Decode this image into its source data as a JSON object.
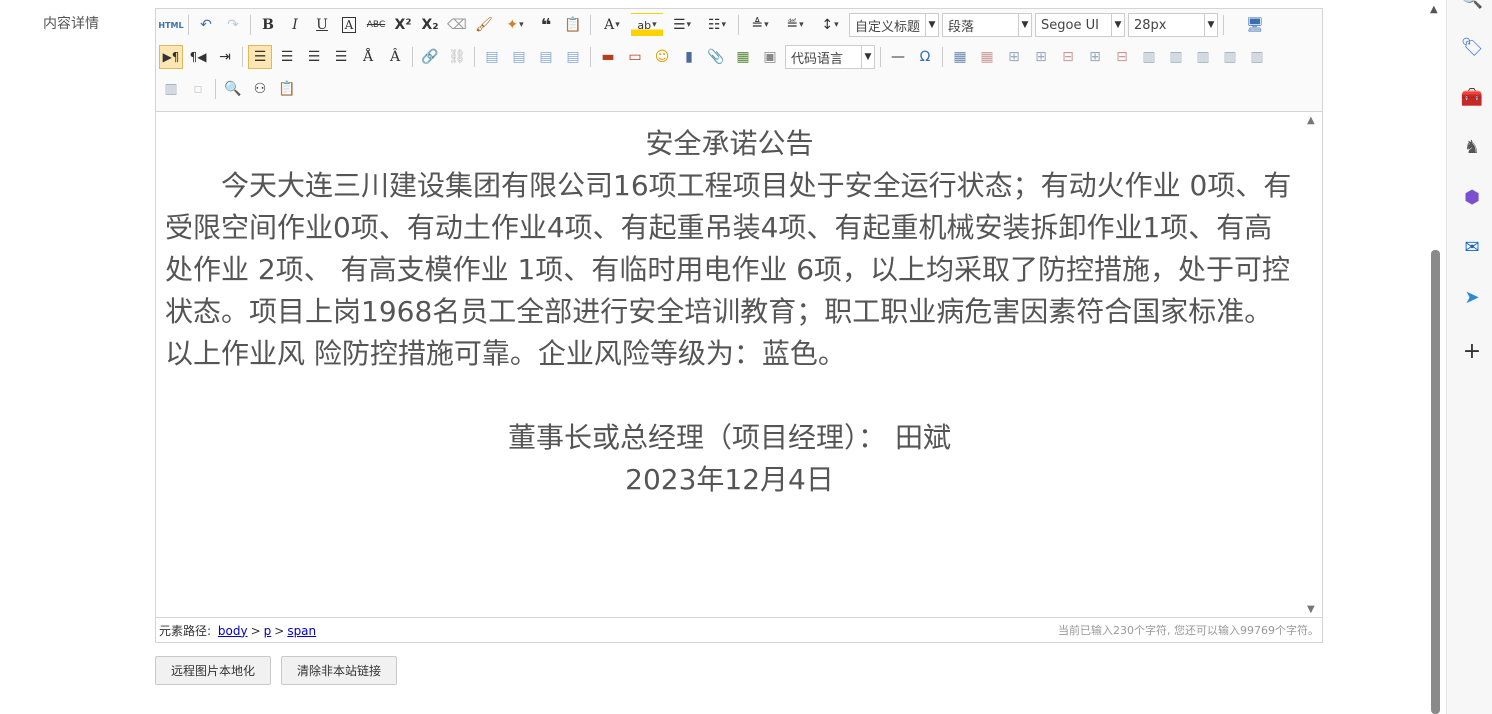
{
  "page": {
    "field_label": "内容详情"
  },
  "toolbar": {
    "font_family_label": "自定义标题",
    "paragraph_format": "段落",
    "font_name": "Segoe UI",
    "font_size": "28px",
    "code_language": "代码语言",
    "icons": [
      "source-html",
      "undo",
      "redo",
      "bold",
      "italic",
      "underline",
      "border",
      "strikethrough",
      "superscript",
      "subscript",
      "eraser",
      "format-painter",
      "auto-typeset",
      "blockquote",
      "paste-plain",
      "font-color",
      "background-color",
      "ordered-list",
      "unordered-list",
      "row-spacing-top",
      "row-spacing-bottom",
      "line-height",
      "fullscreen",
      "ltr",
      "rtl",
      "indent",
      "align-left",
      "align-center",
      "align-right",
      "justify",
      "text-direction",
      "text-transform",
      "link",
      "unlink",
      "image-left",
      "image-none",
      "image-right",
      "image-center",
      "insert-image",
      "emotion",
      "multi-image",
      "video",
      "attachment",
      "map",
      "template",
      "horizontal-rule",
      "special-char",
      "insert-table",
      "delete-table",
      "insert-paragraph",
      "insert-row",
      "delete-row",
      "insert-column",
      "delete-column",
      "merge-cells",
      "merge-right",
      "merge-down",
      "split-cells",
      "split-rows",
      "split-cols",
      "charts",
      "background",
      "search-replace",
      "binoculars",
      "paste-from-word"
    ]
  },
  "content": {
    "title": "安全承诺公告",
    "body": "今天大连三川建设集团有限公司16项工程项目处于安全运行状态；有动火作业 0项、有受限空间作业0项、有动土作业4项、有起重吊装4项、有起重机械安装拆卸作业1项、有高处作业 2项、 有高支模作业 1项、有临时用电作业 6项，以上均采取了防控措施，处于可控状态。项目上岗1968名员工全部进行安全培训教育；职工职业病危害因素符合国家标准。以上作业风 险防控措施可靠。企业风险等级为：蓝色。",
    "signature": "董事长或总经理（项目经理）：  田斌",
    "date": "2023年12月4日"
  },
  "statusbar": {
    "path_label": "元素路径:",
    "path": [
      "body",
      "p",
      "span"
    ],
    "char_count": "当前已输入230个字符, 您还可以输入99769个字符。"
  },
  "buttons": {
    "localize_images": "远程图片本地化",
    "clear_links": "清除非本站链接"
  },
  "edge_bar": {
    "icons": [
      "search-icon",
      "tag-icon",
      "toolbox-icon",
      "chess-icon",
      "copilot-icon",
      "outlook-icon",
      "send-icon",
      "add-icon"
    ]
  }
}
